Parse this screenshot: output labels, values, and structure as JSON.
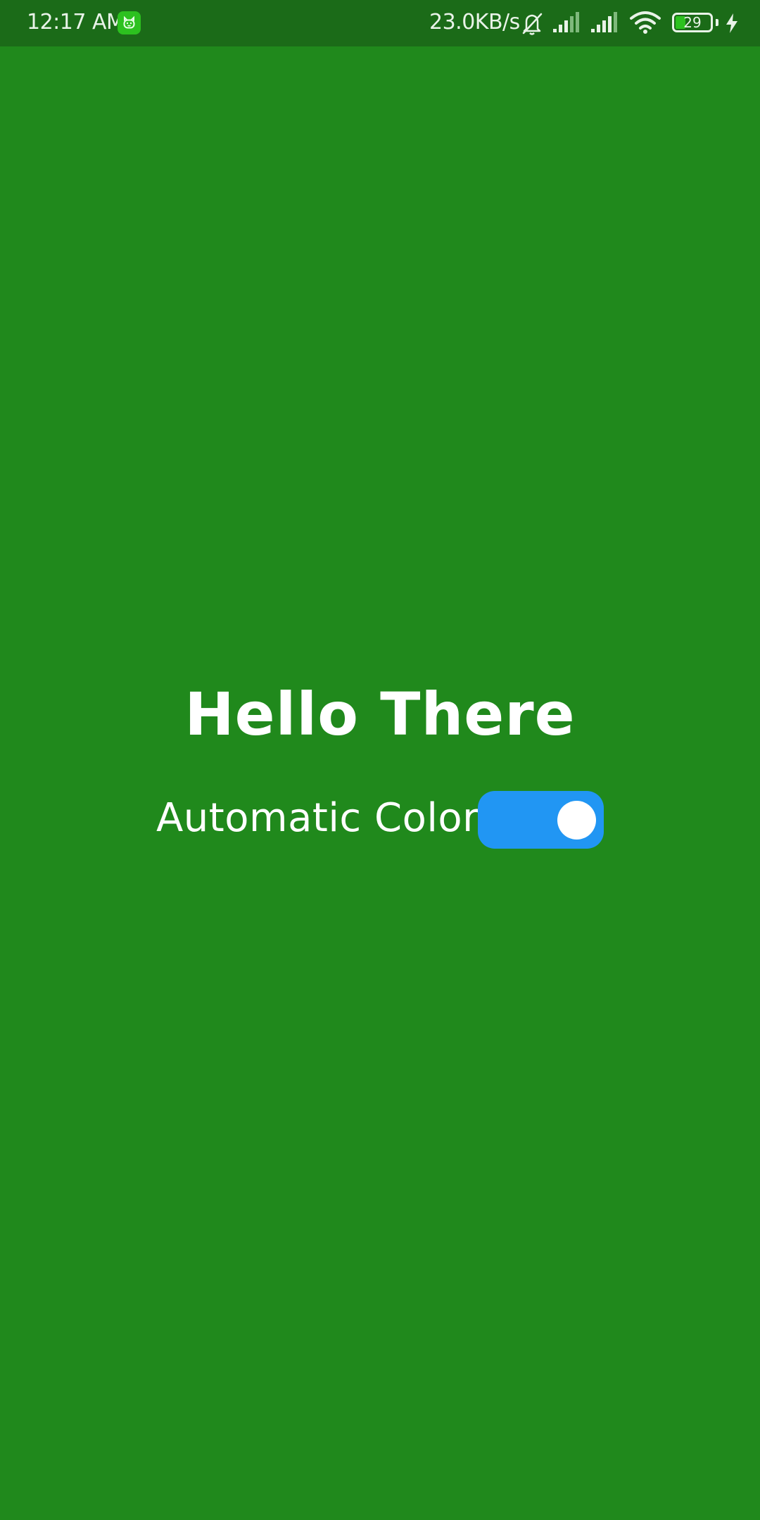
{
  "status_bar": {
    "time": "12:17 AM",
    "app_icon": "android-cat-icon",
    "net_speed": "23.0KB/s",
    "icons": [
      "bell-off-icon",
      "signal-icon",
      "signal-icon",
      "wifi-icon",
      "battery-icon",
      "charging-bolt-icon"
    ],
    "battery_level": "29"
  },
  "main": {
    "title": "Hello There",
    "toggle": {
      "label": "Automatic Color",
      "state": "on"
    }
  },
  "colors": {
    "background": "#20891c",
    "status_bar": "#1b6b18",
    "switch_track": "#2196f3",
    "switch_knob": "#ffffff",
    "text": "#ffffff"
  }
}
